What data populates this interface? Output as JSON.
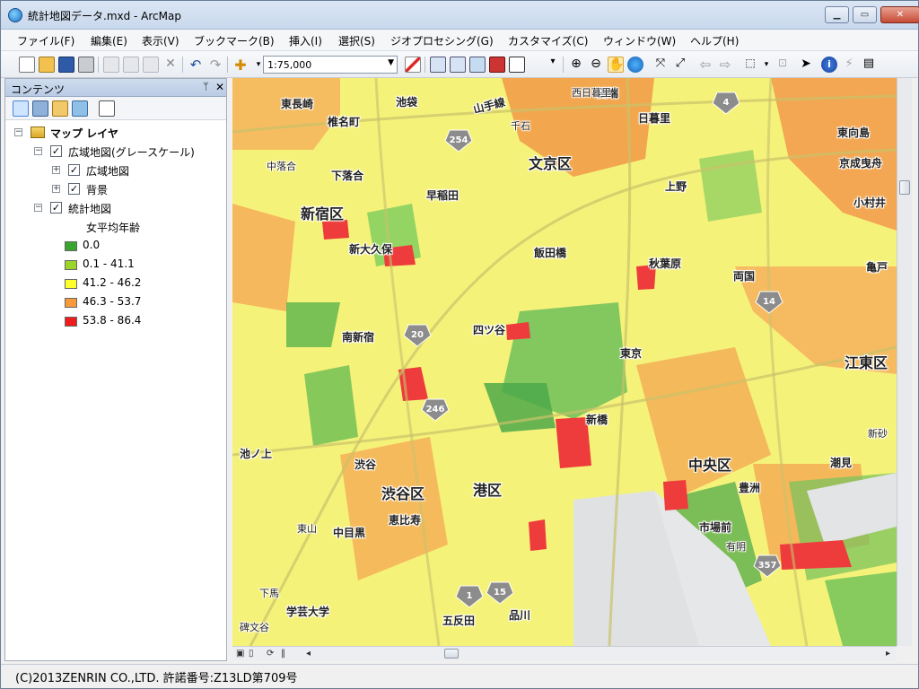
{
  "window": {
    "title": "統計地図データ.mxd - ArcMap",
    "minimize": "▁",
    "maximize": "▭",
    "close": "✕"
  },
  "menu": [
    "ファイル(F)",
    "編集(E)",
    "表示(V)",
    "ブックマーク(B)",
    "挿入(I)",
    "選択(S)",
    "ジオプロセシング(G)",
    "カスタマイズ(C)",
    "ウィンドウ(W)",
    "ヘルプ(H)"
  ],
  "toolbar": {
    "scale": "1:75,000"
  },
  "toc": {
    "title": "コンテンツ",
    "pin": "ᛘ",
    "close": "✕",
    "root_layer": "マップ レイヤ",
    "group1": "広域地図(グレースケール)",
    "group1_child1": "広域地図",
    "group1_child2": "背景",
    "group2": "統計地図",
    "legend_title": "女平均年齢",
    "legend": [
      {
        "label": "0.0",
        "color": "#3aa52e"
      },
      {
        "label": "0.1 - 41.1",
        "color": "#9bd42a"
      },
      {
        "label": "41.2 - 46.2",
        "color": "#ffff2e"
      },
      {
        "label": "46.3 - 53.7",
        "color": "#f99a3a"
      },
      {
        "label": "53.8 - 86.4",
        "color": "#ee1c1c"
      }
    ]
  },
  "map": {
    "labels": {
      "wards": [
        "文京区",
        "新宿区",
        "渋谷区",
        "港区",
        "中央区",
        "江東区"
      ],
      "places": [
        "東長崎",
        "池袋",
        "椎名町",
        "山手線",
        "田端",
        "日暮里",
        "東向島",
        "京成曳舟",
        "千石",
        "中落合",
        "下落合",
        "早稲田",
        "上野",
        "小村井",
        "新大久保",
        "飯田橋",
        "秋葉原",
        "両国",
        "亀戸",
        "四ツ谷",
        "南新宿",
        "東京",
        "新橋",
        "池ノ上",
        "渋谷",
        "新砂",
        "潮見",
        "豊洲",
        "恵比寿",
        "東山",
        "中目黒",
        "市場前",
        "有明",
        "下馬",
        "学芸大学",
        "五反田",
        "品川",
        "碑文谷",
        "西日暮里"
      ],
      "routes": [
        "4",
        "254",
        "14",
        "20",
        "246",
        "357",
        "1",
        "15"
      ]
    }
  },
  "status": {
    "copyright": "(C)2013ZENRIN CO.,LTD. 許諾番号:Z13LD第709号"
  }
}
